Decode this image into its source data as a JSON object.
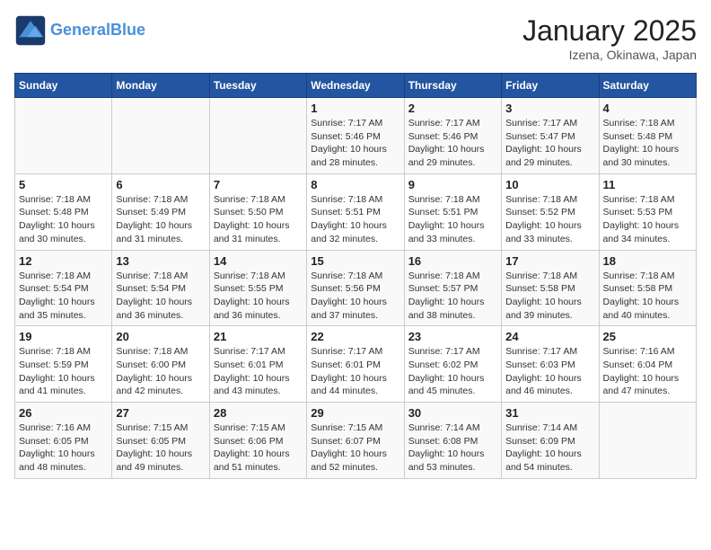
{
  "header": {
    "logo_line1": "General",
    "logo_line2": "Blue",
    "month": "January 2025",
    "location": "Izena, Okinawa, Japan"
  },
  "weekdays": [
    "Sunday",
    "Monday",
    "Tuesday",
    "Wednesday",
    "Thursday",
    "Friday",
    "Saturday"
  ],
  "weeks": [
    [
      {
        "day": "",
        "info": ""
      },
      {
        "day": "",
        "info": ""
      },
      {
        "day": "",
        "info": ""
      },
      {
        "day": "1",
        "info": "Sunrise: 7:17 AM\nSunset: 5:46 PM\nDaylight: 10 hours\nand 28 minutes."
      },
      {
        "day": "2",
        "info": "Sunrise: 7:17 AM\nSunset: 5:46 PM\nDaylight: 10 hours\nand 29 minutes."
      },
      {
        "day": "3",
        "info": "Sunrise: 7:17 AM\nSunset: 5:47 PM\nDaylight: 10 hours\nand 29 minutes."
      },
      {
        "day": "4",
        "info": "Sunrise: 7:18 AM\nSunset: 5:48 PM\nDaylight: 10 hours\nand 30 minutes."
      }
    ],
    [
      {
        "day": "5",
        "info": "Sunrise: 7:18 AM\nSunset: 5:48 PM\nDaylight: 10 hours\nand 30 minutes."
      },
      {
        "day": "6",
        "info": "Sunrise: 7:18 AM\nSunset: 5:49 PM\nDaylight: 10 hours\nand 31 minutes."
      },
      {
        "day": "7",
        "info": "Sunrise: 7:18 AM\nSunset: 5:50 PM\nDaylight: 10 hours\nand 31 minutes."
      },
      {
        "day": "8",
        "info": "Sunrise: 7:18 AM\nSunset: 5:51 PM\nDaylight: 10 hours\nand 32 minutes."
      },
      {
        "day": "9",
        "info": "Sunrise: 7:18 AM\nSunset: 5:51 PM\nDaylight: 10 hours\nand 33 minutes."
      },
      {
        "day": "10",
        "info": "Sunrise: 7:18 AM\nSunset: 5:52 PM\nDaylight: 10 hours\nand 33 minutes."
      },
      {
        "day": "11",
        "info": "Sunrise: 7:18 AM\nSunset: 5:53 PM\nDaylight: 10 hours\nand 34 minutes."
      }
    ],
    [
      {
        "day": "12",
        "info": "Sunrise: 7:18 AM\nSunset: 5:54 PM\nDaylight: 10 hours\nand 35 minutes."
      },
      {
        "day": "13",
        "info": "Sunrise: 7:18 AM\nSunset: 5:54 PM\nDaylight: 10 hours\nand 36 minutes."
      },
      {
        "day": "14",
        "info": "Sunrise: 7:18 AM\nSunset: 5:55 PM\nDaylight: 10 hours\nand 36 minutes."
      },
      {
        "day": "15",
        "info": "Sunrise: 7:18 AM\nSunset: 5:56 PM\nDaylight: 10 hours\nand 37 minutes."
      },
      {
        "day": "16",
        "info": "Sunrise: 7:18 AM\nSunset: 5:57 PM\nDaylight: 10 hours\nand 38 minutes."
      },
      {
        "day": "17",
        "info": "Sunrise: 7:18 AM\nSunset: 5:58 PM\nDaylight: 10 hours\nand 39 minutes."
      },
      {
        "day": "18",
        "info": "Sunrise: 7:18 AM\nSunset: 5:58 PM\nDaylight: 10 hours\nand 40 minutes."
      }
    ],
    [
      {
        "day": "19",
        "info": "Sunrise: 7:18 AM\nSunset: 5:59 PM\nDaylight: 10 hours\nand 41 minutes."
      },
      {
        "day": "20",
        "info": "Sunrise: 7:18 AM\nSunset: 6:00 PM\nDaylight: 10 hours\nand 42 minutes."
      },
      {
        "day": "21",
        "info": "Sunrise: 7:17 AM\nSunset: 6:01 PM\nDaylight: 10 hours\nand 43 minutes."
      },
      {
        "day": "22",
        "info": "Sunrise: 7:17 AM\nSunset: 6:01 PM\nDaylight: 10 hours\nand 44 minutes."
      },
      {
        "day": "23",
        "info": "Sunrise: 7:17 AM\nSunset: 6:02 PM\nDaylight: 10 hours\nand 45 minutes."
      },
      {
        "day": "24",
        "info": "Sunrise: 7:17 AM\nSunset: 6:03 PM\nDaylight: 10 hours\nand 46 minutes."
      },
      {
        "day": "25",
        "info": "Sunrise: 7:16 AM\nSunset: 6:04 PM\nDaylight: 10 hours\nand 47 minutes."
      }
    ],
    [
      {
        "day": "26",
        "info": "Sunrise: 7:16 AM\nSunset: 6:05 PM\nDaylight: 10 hours\nand 48 minutes."
      },
      {
        "day": "27",
        "info": "Sunrise: 7:15 AM\nSunset: 6:05 PM\nDaylight: 10 hours\nand 49 minutes."
      },
      {
        "day": "28",
        "info": "Sunrise: 7:15 AM\nSunset: 6:06 PM\nDaylight: 10 hours\nand 51 minutes."
      },
      {
        "day": "29",
        "info": "Sunrise: 7:15 AM\nSunset: 6:07 PM\nDaylight: 10 hours\nand 52 minutes."
      },
      {
        "day": "30",
        "info": "Sunrise: 7:14 AM\nSunset: 6:08 PM\nDaylight: 10 hours\nand 53 minutes."
      },
      {
        "day": "31",
        "info": "Sunrise: 7:14 AM\nSunset: 6:09 PM\nDaylight: 10 hours\nand 54 minutes."
      },
      {
        "day": "",
        "info": ""
      }
    ]
  ]
}
